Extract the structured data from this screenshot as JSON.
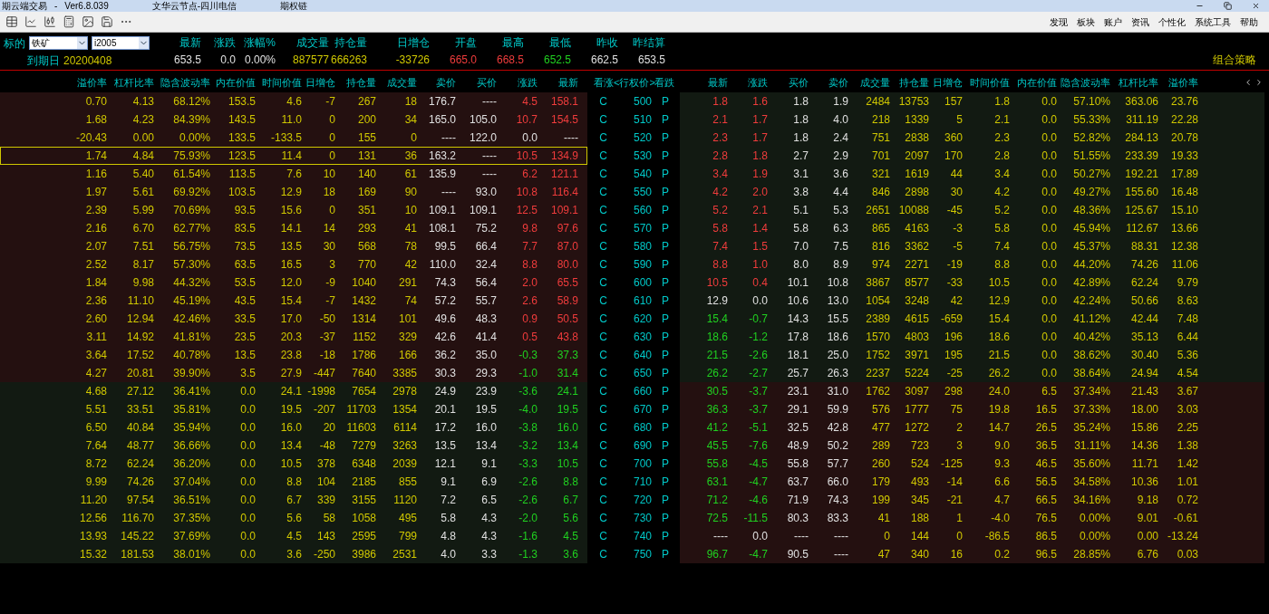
{
  "window": {
    "title_parts": [
      "期云端交易",
      "-",
      "Ver6.8.039",
      "文华云节点-四川电信",
      "期权链"
    ]
  },
  "menu": [
    "发现",
    "板块",
    "账户",
    "资讯",
    "个性化",
    "系统工具",
    "帮助"
  ],
  "underlying": {
    "label": "标的",
    "product": "铁矿",
    "contract": "i2005",
    "expiry_label": "到期日",
    "expiry": "20200408"
  },
  "quotes": [
    {
      "label": "最新",
      "value": "653.5",
      "color": "#e0e0e0"
    },
    {
      "label": "涨跌",
      "value": "0.0",
      "color": "#e0e0e0"
    },
    {
      "label": "涨幅%",
      "value": "0.00%",
      "color": "#e0e0e0"
    },
    {
      "label": "成交量",
      "value": "887577",
      "color": "#d0c800"
    },
    {
      "label": "持仓量",
      "value": "666263",
      "color": "#d0c800"
    },
    {
      "label": "日增仓",
      "value": "-33726",
      "color": "#d0c800"
    },
    {
      "label": "开盘",
      "value": "665.0",
      "color": "#f03c3c"
    },
    {
      "label": "最高",
      "value": "668.5",
      "color": "#f03c3c"
    },
    {
      "label": "最低",
      "value": "652.5",
      "color": "#20d020"
    },
    {
      "label": "昨收",
      "value": "662.5",
      "color": "#e0e0e0"
    },
    {
      "label": "昨结算",
      "value": "653.5",
      "color": "#e0e0e0"
    }
  ],
  "strategy_link": "组合策略",
  "call_columns": [
    "溢价率",
    "杠杆比率",
    "隐含波动率",
    "内在价值",
    "时间价值",
    "日增仓",
    "持仓量",
    "成交量",
    "卖价",
    "买价",
    "涨跌",
    "最新"
  ],
  "middle_columns": [
    "看涨",
    "<行权价>",
    "看跌"
  ],
  "put_columns": [
    "最新",
    "涨跌",
    "买价",
    "卖价",
    "成交量",
    "持仓量",
    "日增仓",
    "时间价值",
    "内在价值",
    "隐含波动率",
    "杠杆比率",
    "溢价率"
  ],
  "rows": [
    {
      "strike": "500",
      "call_label": "C",
      "put_label": "P",
      "call_itm": true,
      "selected": false,
      "call_move": {
        "color": "#f03c3c"
      },
      "put_move": {
        "color": "#f03c3c"
      },
      "call": [
        "0.70",
        "4.13",
        "68.12%",
        "153.5",
        "4.6",
        "-7",
        "267",
        "18",
        "176.7",
        "----",
        "4.5",
        "158.1"
      ],
      "put": [
        "1.8",
        "1.6",
        "1.8",
        "1.9",
        "2484",
        "13753",
        "157",
        "1.8",
        "0.0",
        "57.10%",
        "363.06",
        "23.76"
      ]
    },
    {
      "strike": "510",
      "call_label": "C",
      "put_label": "P",
      "call_itm": true,
      "selected": false,
      "call_move": {
        "color": "#f03c3c"
      },
      "put_move": {
        "color": "#f03c3c"
      },
      "call": [
        "1.68",
        "4.23",
        "84.39%",
        "143.5",
        "11.0",
        "0",
        "200",
        "34",
        "165.0",
        "105.0",
        "10.7",
        "154.5"
      ],
      "put": [
        "2.1",
        "1.7",
        "1.8",
        "4.0",
        "218",
        "1339",
        "5",
        "2.1",
        "0.0",
        "55.33%",
        "311.19",
        "22.28"
      ]
    },
    {
      "strike": "520",
      "call_label": "C",
      "put_label": "P",
      "call_itm": true,
      "selected": false,
      "call_move": {
        "color": "#e0e0e0"
      },
      "put_move": {
        "color": "#f03c3c"
      },
      "call": [
        "-20.43",
        "0.00",
        "0.00%",
        "133.5",
        "-133.5",
        "0",
        "155",
        "0",
        "----",
        "122.0",
        "0.0",
        "----"
      ],
      "put": [
        "2.3",
        "1.7",
        "1.8",
        "2.4",
        "751",
        "2838",
        "360",
        "2.3",
        "0.0",
        "52.82%",
        "284.13",
        "20.78"
      ]
    },
    {
      "strike": "530",
      "call_label": "C",
      "put_label": "P",
      "call_itm": true,
      "selected": true,
      "call_move": {
        "color": "#f03c3c"
      },
      "put_move": {
        "color": "#f03c3c"
      },
      "call": [
        "1.74",
        "4.84",
        "75.93%",
        "123.5",
        "11.4",
        "0",
        "131",
        "36",
        "163.2",
        "----",
        "10.5",
        "134.9"
      ],
      "put": [
        "2.8",
        "1.8",
        "2.7",
        "2.9",
        "701",
        "2097",
        "170",
        "2.8",
        "0.0",
        "51.55%",
        "233.39",
        "19.33"
      ]
    },
    {
      "strike": "540",
      "call_label": "C",
      "put_label": "P",
      "call_itm": true,
      "selected": false,
      "call_move": {
        "color": "#f03c3c"
      },
      "put_move": {
        "color": "#f03c3c"
      },
      "call": [
        "1.16",
        "5.40",
        "61.54%",
        "113.5",
        "7.6",
        "10",
        "140",
        "61",
        "135.9",
        "----",
        "6.2",
        "121.1"
      ],
      "put": [
        "3.4",
        "1.9",
        "3.1",
        "3.6",
        "321",
        "1619",
        "44",
        "3.4",
        "0.0",
        "50.27%",
        "192.21",
        "17.89"
      ]
    },
    {
      "strike": "550",
      "call_label": "C",
      "put_label": "P",
      "call_itm": true,
      "selected": false,
      "call_move": {
        "color": "#f03c3c"
      },
      "put_move": {
        "color": "#f03c3c"
      },
      "call": [
        "1.97",
        "5.61",
        "69.92%",
        "103.5",
        "12.9",
        "18",
        "169",
        "90",
        "----",
        "93.0",
        "10.8",
        "116.4"
      ],
      "put": [
        "4.2",
        "2.0",
        "3.8",
        "4.4",
        "846",
        "2898",
        "30",
        "4.2",
        "0.0",
        "49.27%",
        "155.60",
        "16.48"
      ]
    },
    {
      "strike": "560",
      "call_label": "C",
      "put_label": "P",
      "call_itm": true,
      "selected": false,
      "call_move": {
        "color": "#f03c3c"
      },
      "put_move": {
        "color": "#f03c3c"
      },
      "call": [
        "2.39",
        "5.99",
        "70.69%",
        "93.5",
        "15.6",
        "0",
        "351",
        "10",
        "109.1",
        "109.1",
        "12.5",
        "109.1"
      ],
      "put": [
        "5.2",
        "2.1",
        "5.1",
        "5.3",
        "2651",
        "10088",
        "-45",
        "5.2",
        "0.0",
        "48.36%",
        "125.67",
        "15.10"
      ]
    },
    {
      "strike": "570",
      "call_label": "C",
      "put_label": "P",
      "call_itm": true,
      "selected": false,
      "call_move": {
        "color": "#f03c3c"
      },
      "put_move": {
        "color": "#f03c3c"
      },
      "call": [
        "2.16",
        "6.70",
        "62.77%",
        "83.5",
        "14.1",
        "14",
        "293",
        "41",
        "108.1",
        "75.2",
        "9.8",
        "97.6"
      ],
      "put": [
        "5.8",
        "1.4",
        "5.8",
        "6.3",
        "865",
        "4163",
        "-3",
        "5.8",
        "0.0",
        "45.94%",
        "112.67",
        "13.66"
      ]
    },
    {
      "strike": "580",
      "call_label": "C",
      "put_label": "P",
      "call_itm": true,
      "selected": false,
      "call_move": {
        "color": "#f03c3c"
      },
      "put_move": {
        "color": "#f03c3c"
      },
      "call": [
        "2.07",
        "7.51",
        "56.75%",
        "73.5",
        "13.5",
        "30",
        "568",
        "78",
        "99.5",
        "66.4",
        "7.7",
        "87.0"
      ],
      "put": [
        "7.4",
        "1.5",
        "7.0",
        "7.5",
        "816",
        "3362",
        "-5",
        "7.4",
        "0.0",
        "45.37%",
        "88.31",
        "12.38"
      ]
    },
    {
      "strike": "590",
      "call_label": "C",
      "put_label": "P",
      "call_itm": true,
      "selected": false,
      "call_move": {
        "color": "#f03c3c"
      },
      "put_move": {
        "color": "#f03c3c"
      },
      "call": [
        "2.52",
        "8.17",
        "57.30%",
        "63.5",
        "16.5",
        "3",
        "770",
        "42",
        "110.0",
        "32.4",
        "8.8",
        "80.0"
      ],
      "put": [
        "8.8",
        "1.0",
        "8.0",
        "8.9",
        "974",
        "2271",
        "-19",
        "8.8",
        "0.0",
        "44.20%",
        "74.26",
        "11.06"
      ]
    },
    {
      "strike": "600",
      "call_label": "C",
      "put_label": "P",
      "call_itm": true,
      "selected": false,
      "call_move": {
        "color": "#f03c3c"
      },
      "put_move": {
        "color": "#f03c3c"
      },
      "call": [
        "1.84",
        "9.98",
        "44.32%",
        "53.5",
        "12.0",
        "-9",
        "1040",
        "291",
        "74.3",
        "56.4",
        "2.0",
        "65.5"
      ],
      "put": [
        "10.5",
        "0.4",
        "10.1",
        "10.8",
        "3867",
        "8577",
        "-33",
        "10.5",
        "0.0",
        "42.89%",
        "62.24",
        "9.79"
      ]
    },
    {
      "strike": "610",
      "call_label": "C",
      "put_label": "P",
      "call_itm": true,
      "selected": false,
      "call_move": {
        "color": "#f03c3c"
      },
      "put_move": {
        "color": "#e0e0e0"
      },
      "call": [
        "2.36",
        "11.10",
        "45.19%",
        "43.5",
        "15.4",
        "-7",
        "1432",
        "74",
        "57.2",
        "55.7",
        "2.6",
        "58.9"
      ],
      "put": [
        "12.9",
        "0.0",
        "10.6",
        "13.0",
        "1054",
        "3248",
        "42",
        "12.9",
        "0.0",
        "42.24%",
        "50.66",
        "8.63"
      ]
    },
    {
      "strike": "620",
      "call_label": "C",
      "put_label": "P",
      "call_itm": true,
      "selected": false,
      "call_move": {
        "color": "#f03c3c"
      },
      "put_move": {
        "color": "#20d020"
      },
      "call": [
        "2.60",
        "12.94",
        "42.46%",
        "33.5",
        "17.0",
        "-50",
        "1314",
        "101",
        "49.6",
        "48.3",
        "0.9",
        "50.5"
      ],
      "put": [
        "15.4",
        "-0.7",
        "14.3",
        "15.5",
        "2389",
        "4615",
        "-659",
        "15.4",
        "0.0",
        "41.12%",
        "42.44",
        "7.48"
      ]
    },
    {
      "strike": "630",
      "call_label": "C",
      "put_label": "P",
      "call_itm": true,
      "selected": false,
      "call_move": {
        "color": "#f03c3c"
      },
      "put_move": {
        "color": "#20d020"
      },
      "call": [
        "3.11",
        "14.92",
        "41.81%",
        "23.5",
        "20.3",
        "-37",
        "1152",
        "329",
        "42.6",
        "41.4",
        "0.5",
        "43.8"
      ],
      "put": [
        "18.6",
        "-1.2",
        "17.8",
        "18.6",
        "1570",
        "4803",
        "196",
        "18.6",
        "0.0",
        "40.42%",
        "35.13",
        "6.44"
      ]
    },
    {
      "strike": "640",
      "call_label": "C",
      "put_label": "P",
      "call_itm": true,
      "selected": false,
      "call_move": {
        "color": "#20d020"
      },
      "put_move": {
        "color": "#20d020"
      },
      "call": [
        "3.64",
        "17.52",
        "40.78%",
        "13.5",
        "23.8",
        "-18",
        "1786",
        "166",
        "36.2",
        "35.0",
        "-0.3",
        "37.3"
      ],
      "put": [
        "21.5",
        "-2.6",
        "18.1",
        "25.0",
        "1752",
        "3971",
        "195",
        "21.5",
        "0.0",
        "38.62%",
        "30.40",
        "5.36"
      ]
    },
    {
      "strike": "650",
      "call_label": "C",
      "put_label": "P",
      "call_itm": true,
      "selected": false,
      "call_move": {
        "color": "#20d020"
      },
      "put_move": {
        "color": "#20d020"
      },
      "call": [
        "4.27",
        "20.81",
        "39.90%",
        "3.5",
        "27.9",
        "-447",
        "7640",
        "3385",
        "30.3",
        "29.3",
        "-1.0",
        "31.4"
      ],
      "put": [
        "26.2",
        "-2.7",
        "25.7",
        "26.3",
        "2237",
        "5224",
        "-25",
        "26.2",
        "0.0",
        "38.64%",
        "24.94",
        "4.54"
      ]
    },
    {
      "strike": "660",
      "call_label": "C",
      "put_label": "P",
      "call_itm": false,
      "selected": false,
      "call_move": {
        "color": "#20d020"
      },
      "put_move": {
        "color": "#20d020"
      },
      "call": [
        "4.68",
        "27.12",
        "36.41%",
        "0.0",
        "24.1",
        "-1998",
        "7654",
        "2978",
        "24.9",
        "23.9",
        "-3.6",
        "24.1"
      ],
      "put": [
        "30.5",
        "-3.7",
        "23.1",
        "31.0",
        "1762",
        "3097",
        "298",
        "24.0",
        "6.5",
        "37.34%",
        "21.43",
        "3.67"
      ]
    },
    {
      "strike": "670",
      "call_label": "C",
      "put_label": "P",
      "call_itm": false,
      "selected": false,
      "call_move": {
        "color": "#20d020"
      },
      "put_move": {
        "color": "#20d020"
      },
      "call": [
        "5.51",
        "33.51",
        "35.81%",
        "0.0",
        "19.5",
        "-207",
        "11703",
        "1354",
        "20.1",
        "19.5",
        "-4.0",
        "19.5"
      ],
      "put": [
        "36.3",
        "-3.7",
        "29.1",
        "59.9",
        "576",
        "1777",
        "75",
        "19.8",
        "16.5",
        "37.33%",
        "18.00",
        "3.03"
      ]
    },
    {
      "strike": "680",
      "call_label": "C",
      "put_label": "P",
      "call_itm": false,
      "selected": false,
      "call_move": {
        "color": "#20d020"
      },
      "put_move": {
        "color": "#20d020"
      },
      "call": [
        "6.50",
        "40.84",
        "35.94%",
        "0.0",
        "16.0",
        "20",
        "11603",
        "6114",
        "17.2",
        "16.0",
        "-3.8",
        "16.0"
      ],
      "put": [
        "41.2",
        "-5.1",
        "32.5",
        "42.8",
        "477",
        "1272",
        "2",
        "14.7",
        "26.5",
        "35.24%",
        "15.86",
        "2.25"
      ]
    },
    {
      "strike": "690",
      "call_label": "C",
      "put_label": "P",
      "call_itm": false,
      "selected": false,
      "call_move": {
        "color": "#20d020"
      },
      "put_move": {
        "color": "#20d020"
      },
      "call": [
        "7.64",
        "48.77",
        "36.66%",
        "0.0",
        "13.4",
        "-48",
        "7279",
        "3263",
        "13.5",
        "13.4",
        "-3.2",
        "13.4"
      ],
      "put": [
        "45.5",
        "-7.6",
        "48.9",
        "50.2",
        "289",
        "723",
        "3",
        "9.0",
        "36.5",
        "31.11%",
        "14.36",
        "1.38"
      ]
    },
    {
      "strike": "700",
      "call_label": "C",
      "put_label": "P",
      "call_itm": false,
      "selected": false,
      "call_move": {
        "color": "#20d020"
      },
      "put_move": {
        "color": "#20d020"
      },
      "call": [
        "8.72",
        "62.24",
        "36.20%",
        "0.0",
        "10.5",
        "378",
        "6348",
        "2039",
        "12.1",
        "9.1",
        "-3.3",
        "10.5"
      ],
      "put": [
        "55.8",
        "-4.5",
        "55.8",
        "57.7",
        "260",
        "524",
        "-125",
        "9.3",
        "46.5",
        "35.60%",
        "11.71",
        "1.42"
      ]
    },
    {
      "strike": "710",
      "call_label": "C",
      "put_label": "P",
      "call_itm": false,
      "selected": false,
      "call_move": {
        "color": "#20d020"
      },
      "put_move": {
        "color": "#20d020"
      },
      "call": [
        "9.99",
        "74.26",
        "37.04%",
        "0.0",
        "8.8",
        "104",
        "2185",
        "855",
        "9.1",
        "6.9",
        "-2.6",
        "8.8"
      ],
      "put": [
        "63.1",
        "-4.7",
        "63.7",
        "66.0",
        "179",
        "493",
        "-14",
        "6.6",
        "56.5",
        "34.58%",
        "10.36",
        "1.01"
      ]
    },
    {
      "strike": "720",
      "call_label": "C",
      "put_label": "P",
      "call_itm": false,
      "selected": false,
      "call_move": {
        "color": "#20d020"
      },
      "put_move": {
        "color": "#20d020"
      },
      "call": [
        "11.20",
        "97.54",
        "36.51%",
        "0.0",
        "6.7",
        "339",
        "3155",
        "1120",
        "7.2",
        "6.5",
        "-2.6",
        "6.7"
      ],
      "put": [
        "71.2",
        "-4.6",
        "71.9",
        "74.3",
        "199",
        "345",
        "-21",
        "4.7",
        "66.5",
        "34.16%",
        "9.18",
        "0.72"
      ]
    },
    {
      "strike": "730",
      "call_label": "C",
      "put_label": "P",
      "call_itm": false,
      "selected": false,
      "call_move": {
        "color": "#20d020"
      },
      "put_move": {
        "color": "#20d020"
      },
      "call": [
        "12.56",
        "116.70",
        "37.35%",
        "0.0",
        "5.6",
        "58",
        "1058",
        "495",
        "5.8",
        "4.3",
        "-2.0",
        "5.6"
      ],
      "put": [
        "72.5",
        "-11.5",
        "80.3",
        "83.3",
        "41",
        "188",
        "1",
        "-4.0",
        "76.5",
        "0.00%",
        "9.01",
        "-0.61"
      ]
    },
    {
      "strike": "740",
      "call_label": "C",
      "put_label": "P",
      "call_itm": false,
      "selected": false,
      "call_move": {
        "color": "#20d020"
      },
      "put_move": {
        "color": "#e0e0e0"
      },
      "call": [
        "13.93",
        "145.22",
        "37.69%",
        "0.0",
        "4.5",
        "143",
        "2595",
        "799",
        "4.8",
        "4.3",
        "-1.6",
        "4.5"
      ],
      "put": [
        "----",
        "0.0",
        "----",
        "----",
        "0",
        "144",
        "0",
        "-86.5",
        "86.5",
        "0.00%",
        "0.00",
        "-13.24"
      ]
    },
    {
      "strike": "750",
      "call_label": "C",
      "put_label": "P",
      "call_itm": false,
      "selected": false,
      "call_move": {
        "color": "#20d020"
      },
      "put_move": {
        "color": "#20d020"
      },
      "call": [
        "15.32",
        "181.53",
        "38.01%",
        "0.0",
        "3.6",
        "-250",
        "3986",
        "2531",
        "4.0",
        "3.3",
        "-1.3",
        "3.6"
      ],
      "put": [
        "96.7",
        "-4.7",
        "90.5",
        "----",
        "47",
        "340",
        "16",
        "0.2",
        "96.5",
        "28.85%",
        "6.76",
        "0.03"
      ]
    }
  ]
}
